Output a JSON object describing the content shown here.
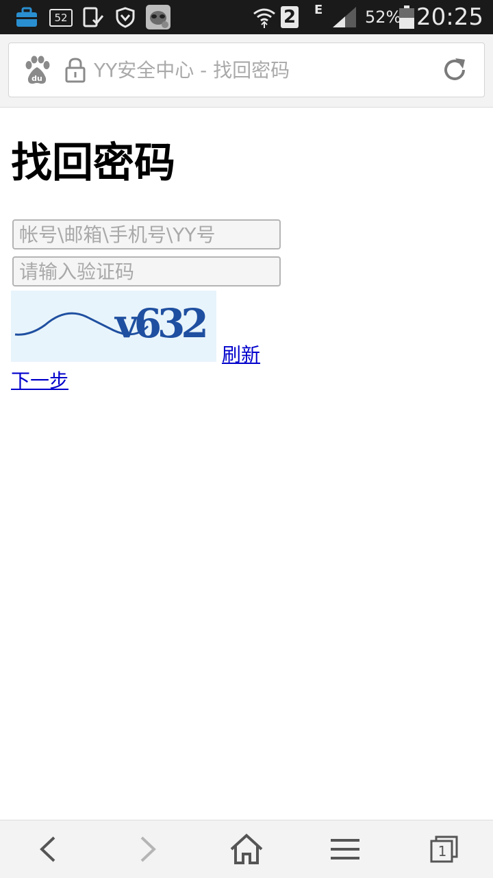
{
  "status_bar": {
    "notification_count": "52",
    "sim_slot": "2",
    "network_type": "E",
    "battery_percent": "52%",
    "time": "20:25",
    "icons": [
      "toolbox-icon",
      "notification-count-icon",
      "phone-check-icon",
      "shield-icon",
      "raccoon-app-icon",
      "wifi-icon",
      "sim-badge-icon",
      "signal-icon",
      "battery-icon"
    ]
  },
  "browser": {
    "page_title": "YY安全中心 - 找回密码",
    "icons": {
      "baidu": "baidu-paw-icon",
      "lock": "lock-icon",
      "reload": "reload-icon"
    }
  },
  "page": {
    "heading": "找回密码",
    "account_placeholder": "帐号\\邮箱\\手机号\\YY号",
    "captcha_placeholder": "请输入验证码",
    "captcha_text": "v632",
    "refresh_label": "刷新",
    "next_label": "下一步"
  },
  "bottom_nav": {
    "tab_count": "1",
    "icons": [
      "back-icon",
      "forward-icon",
      "home-icon",
      "menu-icon",
      "tabs-icon"
    ]
  },
  "colors": {
    "status_bar_bg": "#1a1a1a",
    "link": "#0000cc",
    "captcha_bg": "#e8f4fb",
    "captcha_ink": "#1f4fa0"
  }
}
